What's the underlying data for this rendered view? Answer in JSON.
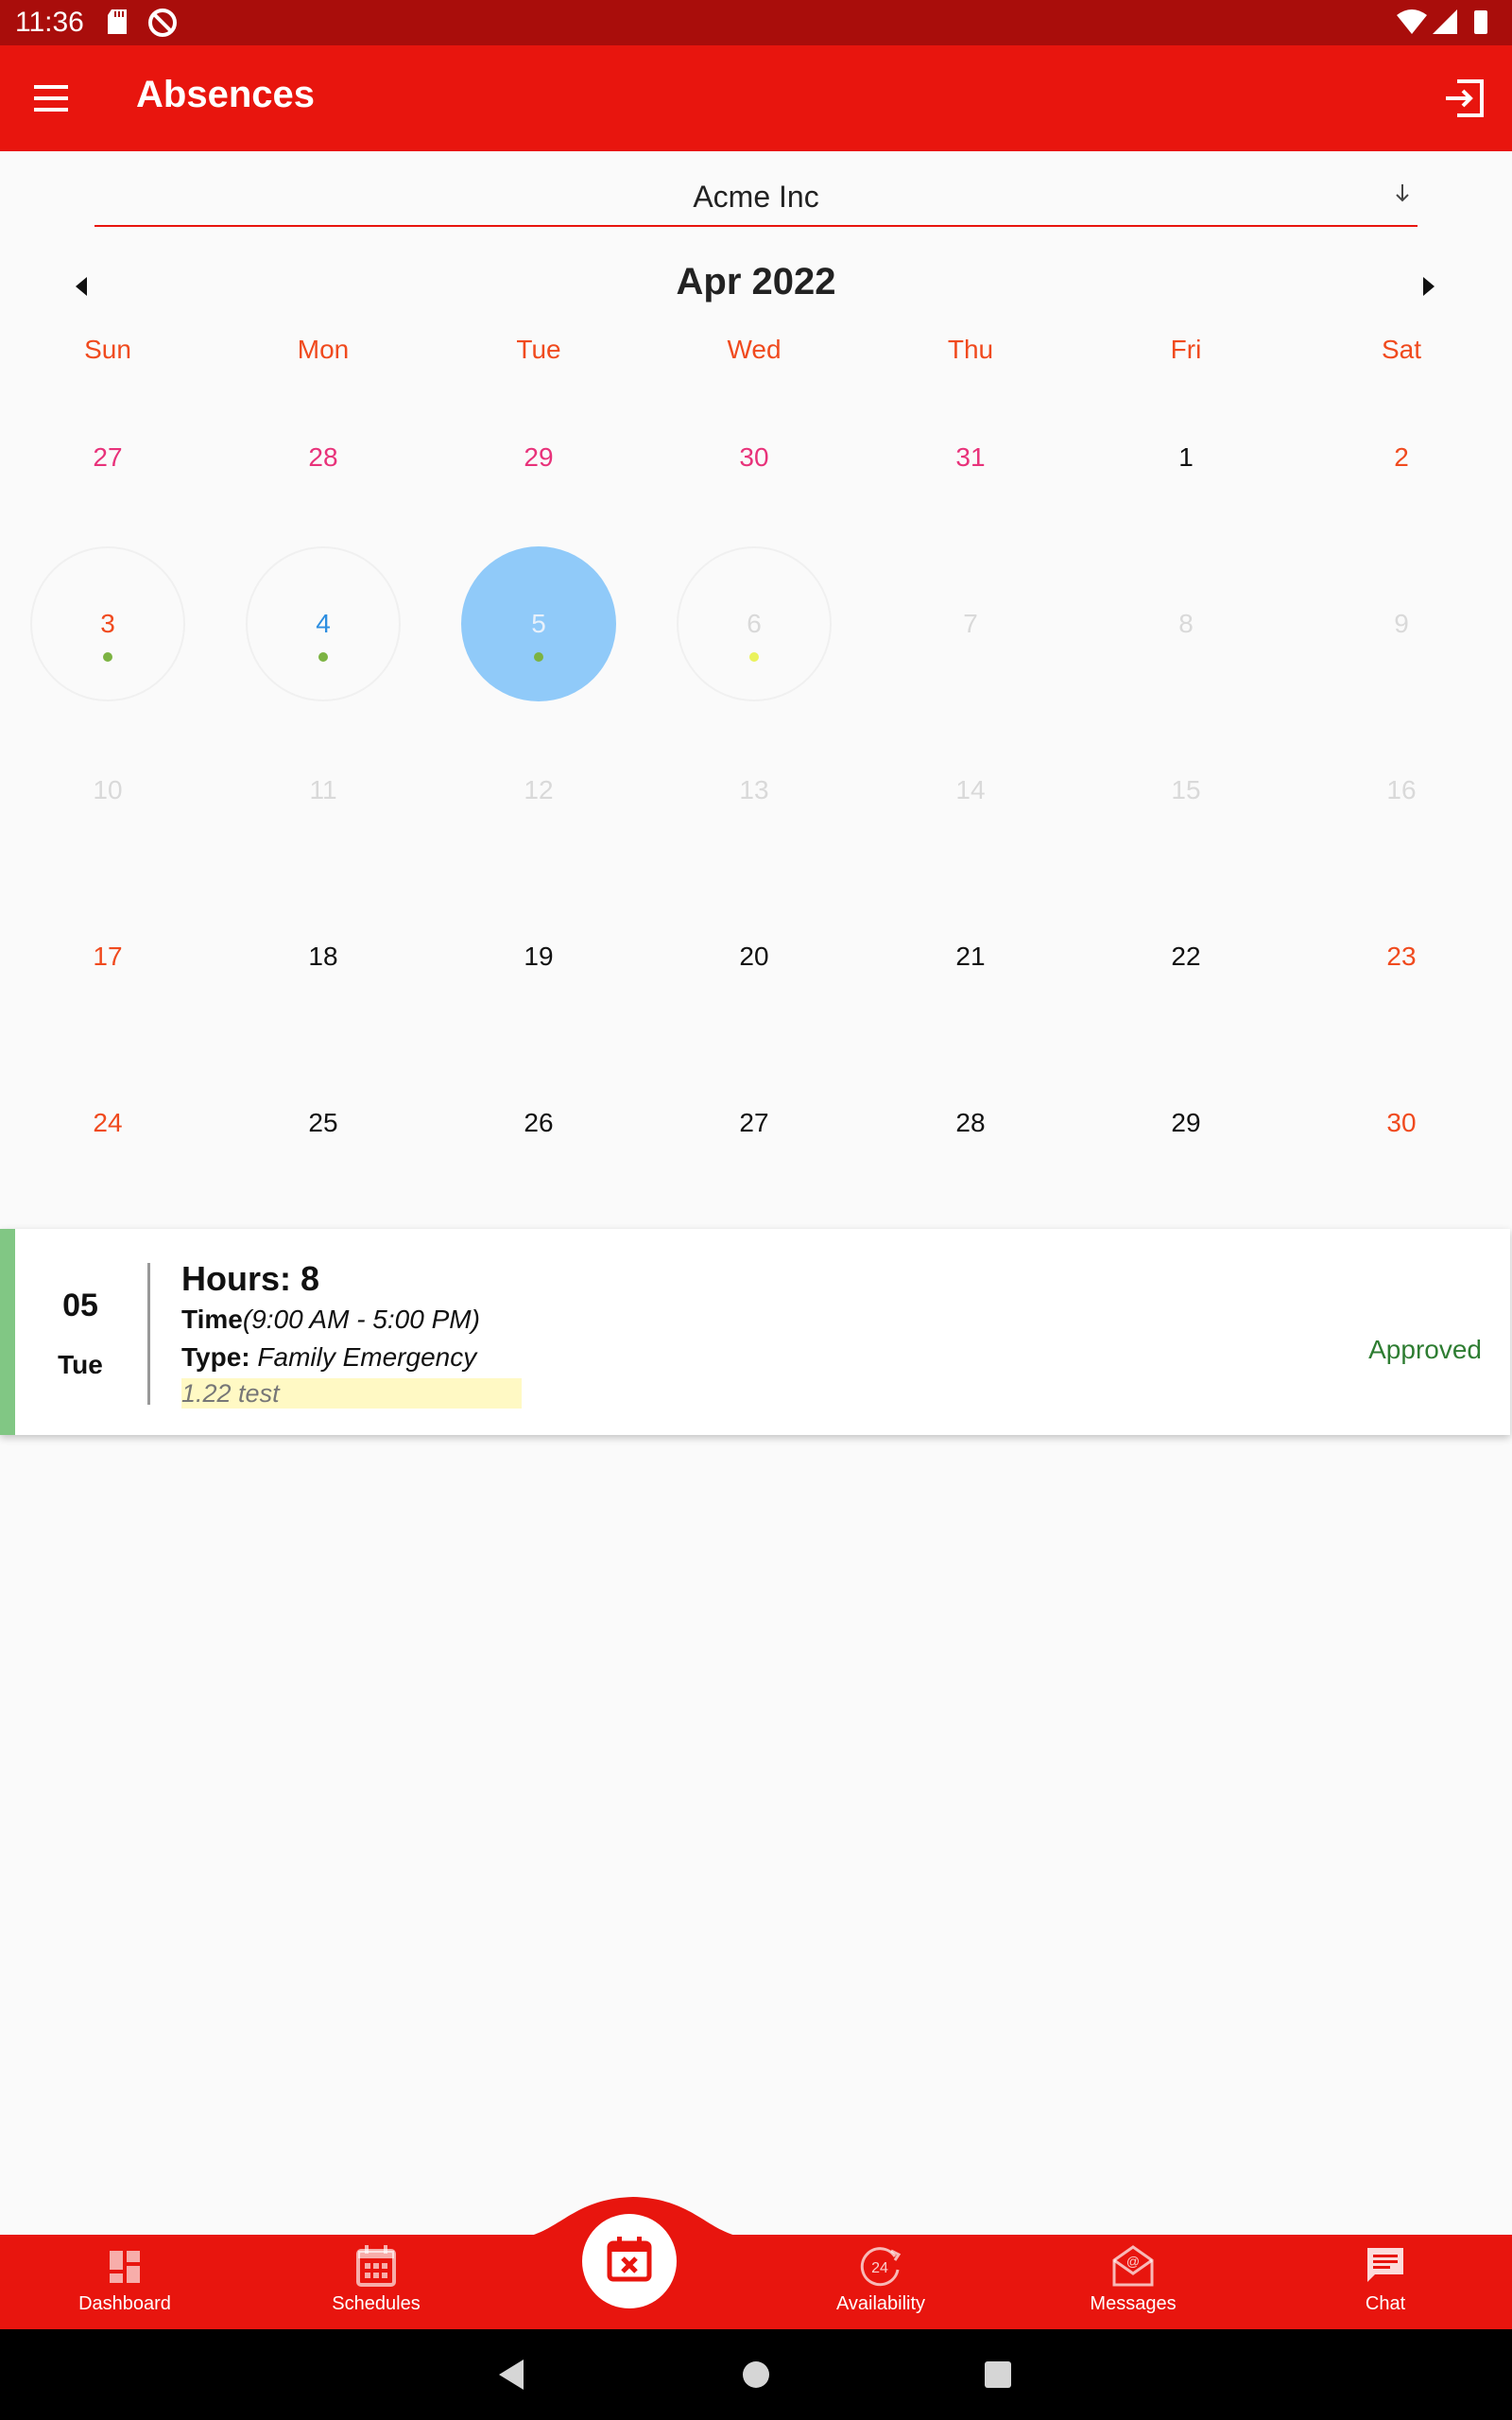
{
  "status_bar": {
    "time": "11:36"
  },
  "app_bar": {
    "title": "Absences"
  },
  "company_select": {
    "value": "Acme Inc"
  },
  "calendar": {
    "month_label": "Apr 2022",
    "weekdays": [
      "Sun",
      "Mon",
      "Tue",
      "Wed",
      "Thu",
      "Fri",
      "Sat"
    ],
    "weeks": [
      [
        {
          "d": "27",
          "c": "pink"
        },
        {
          "d": "28",
          "c": "pink"
        },
        {
          "d": "29",
          "c": "pink"
        },
        {
          "d": "30",
          "c": "pink"
        },
        {
          "d": "31",
          "c": "pink"
        },
        {
          "d": "1",
          "c": "black"
        },
        {
          "d": "2",
          "c": "red"
        }
      ],
      [
        {
          "d": "3",
          "c": "red",
          "ring": true,
          "dot": "#7cb342"
        },
        {
          "d": "4",
          "c": "blue",
          "ring": true,
          "dot": "#7cb342"
        },
        {
          "d": "5",
          "c": "white",
          "selected": true,
          "dot": "#7cb342"
        },
        {
          "d": "6",
          "c": "grey",
          "ring": true,
          "dot": "#eaf25c"
        },
        {
          "d": "7",
          "c": "grey"
        },
        {
          "d": "8",
          "c": "grey"
        },
        {
          "d": "9",
          "c": "grey"
        }
      ],
      [
        {
          "d": "10",
          "c": "grey"
        },
        {
          "d": "11",
          "c": "grey"
        },
        {
          "d": "12",
          "c": "grey"
        },
        {
          "d": "13",
          "c": "grey"
        },
        {
          "d": "14",
          "c": "grey"
        },
        {
          "d": "15",
          "c": "grey"
        },
        {
          "d": "16",
          "c": "grey"
        }
      ],
      [
        {
          "d": "17",
          "c": "red"
        },
        {
          "d": "18",
          "c": "black"
        },
        {
          "d": "19",
          "c": "black"
        },
        {
          "d": "20",
          "c": "black"
        },
        {
          "d": "21",
          "c": "black"
        },
        {
          "d": "22",
          "c": "black"
        },
        {
          "d": "23",
          "c": "red"
        }
      ],
      [
        {
          "d": "24",
          "c": "red"
        },
        {
          "d": "25",
          "c": "black"
        },
        {
          "d": "26",
          "c": "black"
        },
        {
          "d": "27",
          "c": "black"
        },
        {
          "d": "28",
          "c": "black"
        },
        {
          "d": "29",
          "c": "black"
        },
        {
          "d": "30",
          "c": "red"
        }
      ]
    ]
  },
  "absence_card": {
    "day_number": "05",
    "day_name": "Tue",
    "hours_label": "Hours: 8",
    "time_label": "Time",
    "time_value": "(9:00 AM - 5:00 PM)",
    "type_label": "Type:",
    "type_value": "Family Emergency",
    "note": "1.22 test",
    "status": "Approved",
    "status_color": "#2e7d32",
    "strip_color": "#81c784"
  },
  "bottom_nav": {
    "dashboard": "Dashboard",
    "schedules": "Schedules",
    "availability": "Availability",
    "availability_badge": "24",
    "messages": "Messages",
    "chat": "Chat"
  },
  "colors": {
    "primary": "#e8150e",
    "status_bar": "#a90d0b",
    "selected_day": "#90caf9",
    "weekday": "#f04a1e"
  }
}
